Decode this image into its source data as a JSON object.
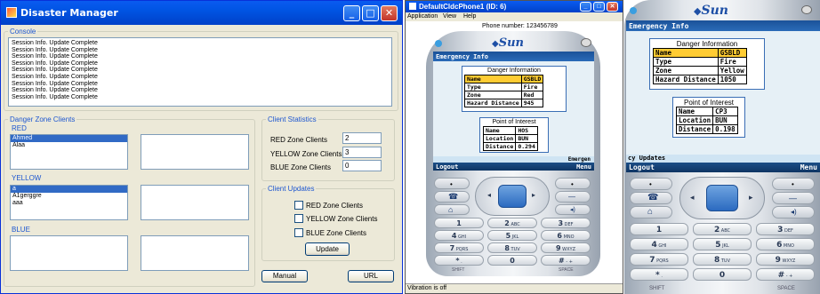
{
  "disaster_manager": {
    "title": "Disaster Manager",
    "controls": {
      "minimize": "_",
      "maximize": "□",
      "close": "✕"
    },
    "console": {
      "legend": "Console",
      "lines": [
        "Session Info. Update Complete",
        "Session Info. Update Complete",
        "Session Info. Update Complete",
        "Session Info. Update Complete",
        "Session Info. Update Complete",
        "Session Info. Update Complete",
        "Session Info. Update Complete",
        "Session Info. Update Complete",
        "Session Info. Update Complete"
      ]
    },
    "danger_zone": {
      "legend": "Danger Zone Clients",
      "red": {
        "label": "RED",
        "items": [
          "Ahmed",
          "Alaa"
        ],
        "selected": 0
      },
      "yellow": {
        "label": "YELLOW",
        "items": [
          "a",
          "A1gerggre",
          "aaa"
        ],
        "selected": 0
      },
      "blue": {
        "label": "BLUE",
        "items": []
      }
    },
    "client_statistics": {
      "legend": "Client Statistics",
      "red_label": "RED Zone Clients",
      "red_value": "2",
      "yellow_label": "YELLOW Zone Clients",
      "yellow_value": "3",
      "blue_label": "BLUE Zone Clients",
      "blue_value": "0"
    },
    "client_updates": {
      "legend": "Client Updates",
      "red": "RED Zone Clients",
      "yellow": "YELLOW Zone Clients",
      "blue": "BLUE Zone Clients",
      "update_button": "Update"
    },
    "manual_button": "Manual",
    "url_button": "URL"
  },
  "phone1": {
    "window_title": "DefaultCldcPhone1 (ID: 6)",
    "menu": [
      "Application",
      "View",
      "Help"
    ],
    "phone_number": "Phone number: 123456789",
    "logo": "Sun",
    "screen_title": "Emergency Info",
    "danger": {
      "heading": "Danger Information",
      "rows": [
        [
          "Name",
          "GSBLD"
        ],
        [
          "Type",
          "Fire"
        ],
        [
          "Zone",
          "Red"
        ],
        [
          "Hazard Distance",
          "945"
        ]
      ]
    },
    "poi": {
      "heading": "Point of Interest",
      "rows": [
        [
          "Name",
          "HOS"
        ],
        [
          "Location",
          "BUN"
        ],
        [
          "Distance",
          "0.294"
        ]
      ]
    },
    "ticker": "Emergen",
    "soft_left": "Logout",
    "soft_right": "Menu",
    "status": "Vibration is off"
  },
  "phone2": {
    "logo": "Sun",
    "screen_title": "Emergency Info",
    "danger": {
      "heading": "Danger Information",
      "rows": [
        [
          "Name",
          "GSBLD"
        ],
        [
          "Type",
          "Fire"
        ],
        [
          "Zone",
          "Yellow"
        ],
        [
          "Hazard Distance",
          "1050"
        ]
      ]
    },
    "poi": {
      "heading": "Point of Interest",
      "rows": [
        [
          "Name",
          "CP3"
        ],
        [
          "Location",
          "BUN"
        ],
        [
          "Distance",
          "0.198"
        ]
      ]
    },
    "ticker": "cy Updates",
    "soft_left": "Logout",
    "soft_right": "Menu"
  },
  "keypad": {
    "keys": [
      [
        "1",
        ""
      ],
      [
        "2",
        "ABC"
      ],
      [
        "3",
        "DEF"
      ],
      [
        "4",
        "GHI"
      ],
      [
        "5",
        "JKL"
      ],
      [
        "6",
        "MNO"
      ],
      [
        "7",
        "PQRS"
      ],
      [
        "8",
        "TUV"
      ],
      [
        "9",
        "WXYZ"
      ],
      [
        "*",
        "."
      ],
      [
        "0",
        ""
      ],
      [
        "#",
        "- +"
      ]
    ],
    "shift": "SHIFT",
    "space": "SPACE"
  },
  "colors": {
    "highlight": "#ffcc33",
    "xp_title": "#0054e3",
    "group_label": "#1e57d0",
    "selection": "#316ac5"
  }
}
